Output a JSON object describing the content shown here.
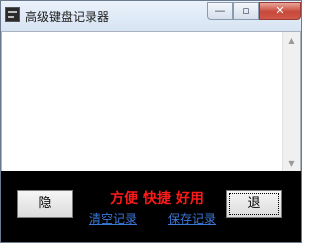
{
  "window": {
    "title": "高级键盘记录器",
    "controls": {
      "minimize": "—",
      "maximize": "▫",
      "close": "✕"
    }
  },
  "log": {
    "text": ""
  },
  "scrollbar": {
    "up": "▲",
    "down": "▼"
  },
  "panel": {
    "hide_label": "隐",
    "slogan": "方便 快捷 好用",
    "clear_link": "清空记录",
    "save_link": "保存记录",
    "exit_label": "退"
  },
  "colors": {
    "slogan": "#ff1a1a",
    "link": "#3a78d8",
    "panel_background": "#000000"
  },
  "icons": {
    "app": "keyboard-app-icon"
  }
}
